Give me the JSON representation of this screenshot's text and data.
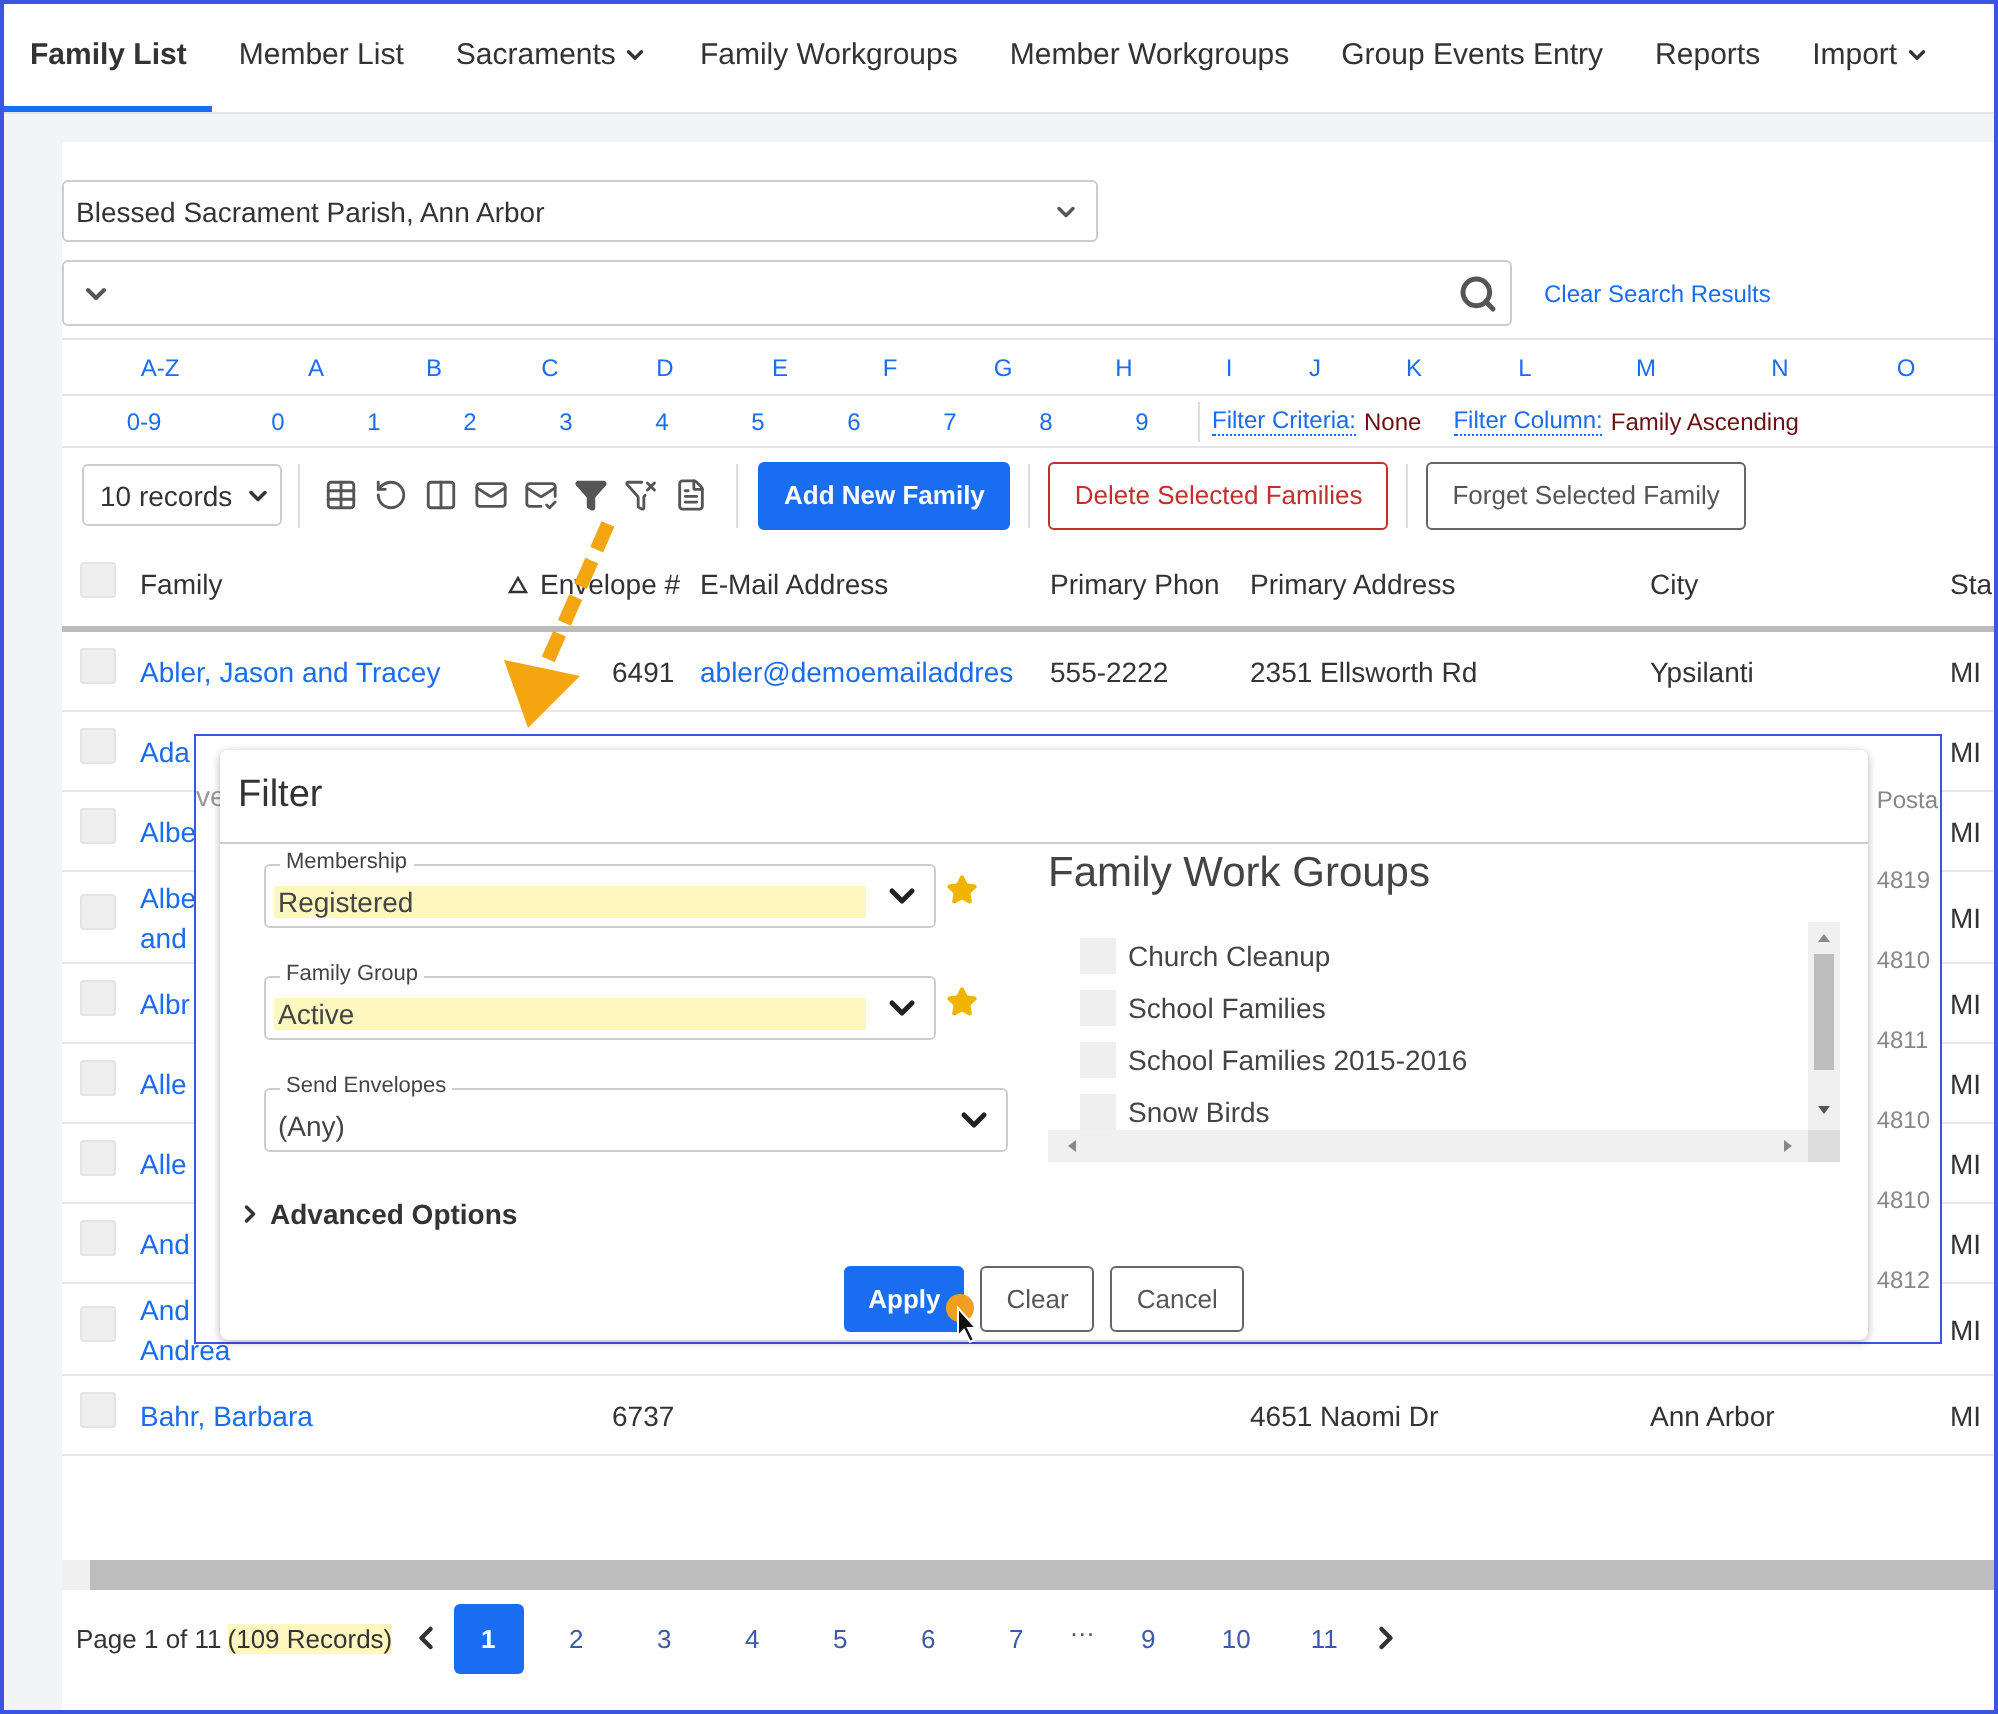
{
  "nav": {
    "tabs": [
      {
        "label": "Family List",
        "selected": true,
        "dropdown": false
      },
      {
        "label": "Member List",
        "selected": false,
        "dropdown": false
      },
      {
        "label": "Sacraments",
        "selected": false,
        "dropdown": true
      },
      {
        "label": "Family Workgroups",
        "selected": false,
        "dropdown": false
      },
      {
        "label": "Member Workgroups",
        "selected": false,
        "dropdown": false
      },
      {
        "label": "Group Events Entry",
        "selected": false,
        "dropdown": false
      },
      {
        "label": "Reports",
        "selected": false,
        "dropdown": false
      },
      {
        "label": "Import",
        "selected": false,
        "dropdown": true
      }
    ]
  },
  "parish_select": {
    "value": "Blessed Sacrament Parish, Ann Arbor"
  },
  "search": {
    "clear_link": "Clear Search Results"
  },
  "letters": [
    "A-Z",
    "A",
    "B",
    "C",
    "D",
    "E",
    "F",
    "G",
    "H",
    "I",
    "J",
    "K",
    "L",
    "M",
    "N",
    "O"
  ],
  "digits": [
    "0-9",
    "0",
    "1",
    "2",
    "3",
    "4",
    "5",
    "6",
    "7",
    "8",
    "9"
  ],
  "filter_criteria": {
    "label": "Filter Criteria:",
    "value": "None"
  },
  "filter_column": {
    "label": "Filter Column:",
    "value": "Family Ascending"
  },
  "toolbar": {
    "records": "10 records",
    "buttons": [
      {
        "label": "Add New Family",
        "kind": "primary"
      },
      {
        "label": "Delete Selected Families",
        "kind": "danger"
      },
      {
        "label": "Forget Selected Family",
        "kind": "secondary"
      }
    ]
  },
  "table": {
    "header_checked": false,
    "columns": [
      {
        "label": "Family",
        "sorted": true
      },
      {
        "label": "Envelope #",
        "sorted": false
      },
      {
        "label": "E-Mail Address",
        "sorted": false
      },
      {
        "label": "Primary Phon",
        "sorted": false
      },
      {
        "label": "Primary Address",
        "sorted": false
      },
      {
        "label": "City",
        "sorted": false
      },
      {
        "label": "Sta"
      }
    ],
    "rows": [
      {
        "checked": false,
        "family": [
          "Abler, Jason and Tracey"
        ],
        "envelope": "6491",
        "email": "abler@demoemailaddres",
        "phone": "555-2222",
        "address": "2351 Ellsworth Rd",
        "city": "Ypsilanti",
        "state": "MI"
      },
      {
        "checked": false,
        "family": [
          "Ada"
        ],
        "state": "MI"
      },
      {
        "checked": false,
        "family": [
          "Albe"
        ],
        "state": "MI"
      },
      {
        "checked": false,
        "family": [
          "Albe",
          "and"
        ],
        "state": "MI"
      },
      {
        "checked": false,
        "family": [
          "Albr"
        ],
        "state": "MI"
      },
      {
        "checked": false,
        "family": [
          "Alle"
        ],
        "state": "MI"
      },
      {
        "checked": false,
        "family": [
          "Alle"
        ],
        "state": "MI"
      },
      {
        "checked": false,
        "family": [
          "And"
        ],
        "state": "MI"
      },
      {
        "checked": false,
        "family": [
          "And",
          "Andrea"
        ],
        "state": "MI"
      },
      {
        "checked": false,
        "family": [
          "Bahr, Barbara"
        ],
        "envelope": "6737",
        "address": "4651 Naomi Dr",
        "city": "Ann Arbor",
        "state": "MI"
      }
    ]
  },
  "inset": {
    "left_fragment": "ve",
    "right_fragments": [
      "Posta",
      "4819",
      "4810",
      "4811",
      "4810",
      "4810",
      "4812"
    ]
  },
  "modal": {
    "title": "Filter",
    "fields": [
      {
        "label": "Membership",
        "value": "Registered",
        "highlighted": true,
        "starred": true
      },
      {
        "label": "Family Group",
        "value": "Active",
        "highlighted": true,
        "starred": true
      },
      {
        "label": "Send Envelopes",
        "value": "(Any)",
        "highlighted": false,
        "starred": false
      }
    ],
    "advanced": {
      "label": "Advanced Options",
      "expanded": false
    },
    "groups": {
      "title": "Family Work Groups",
      "items": [
        {
          "label": "Church Cleanup",
          "checked": false
        },
        {
          "label": "School Families",
          "checked": false
        },
        {
          "label": "School Families 2015-2016",
          "checked": false
        },
        {
          "label": "Snow Birds",
          "checked": false
        }
      ]
    },
    "buttons": [
      {
        "label": "Apply",
        "kind": "primary"
      },
      {
        "label": "Clear",
        "kind": "secondary"
      },
      {
        "label": "Cancel",
        "kind": "secondary"
      }
    ]
  },
  "pagination": {
    "info": "Page 1 of 11",
    "count": "(109 Records)",
    "pages": [
      {
        "label": "1",
        "kind": "page",
        "selected": true
      },
      {
        "label": "2",
        "kind": "page",
        "selected": false
      },
      {
        "label": "3",
        "kind": "page",
        "selected": false
      },
      {
        "label": "4",
        "kind": "page",
        "selected": false
      },
      {
        "label": "5",
        "kind": "page",
        "selected": false
      },
      {
        "label": "6",
        "kind": "page",
        "selected": false
      },
      {
        "label": "7",
        "kind": "page",
        "selected": false
      },
      {
        "label": "…",
        "kind": "gap"
      },
      {
        "label": "9",
        "kind": "page",
        "selected": false
      },
      {
        "label": "10",
        "kind": "page",
        "selected": false
      },
      {
        "label": "11",
        "kind": "page",
        "selected": false
      }
    ]
  }
}
